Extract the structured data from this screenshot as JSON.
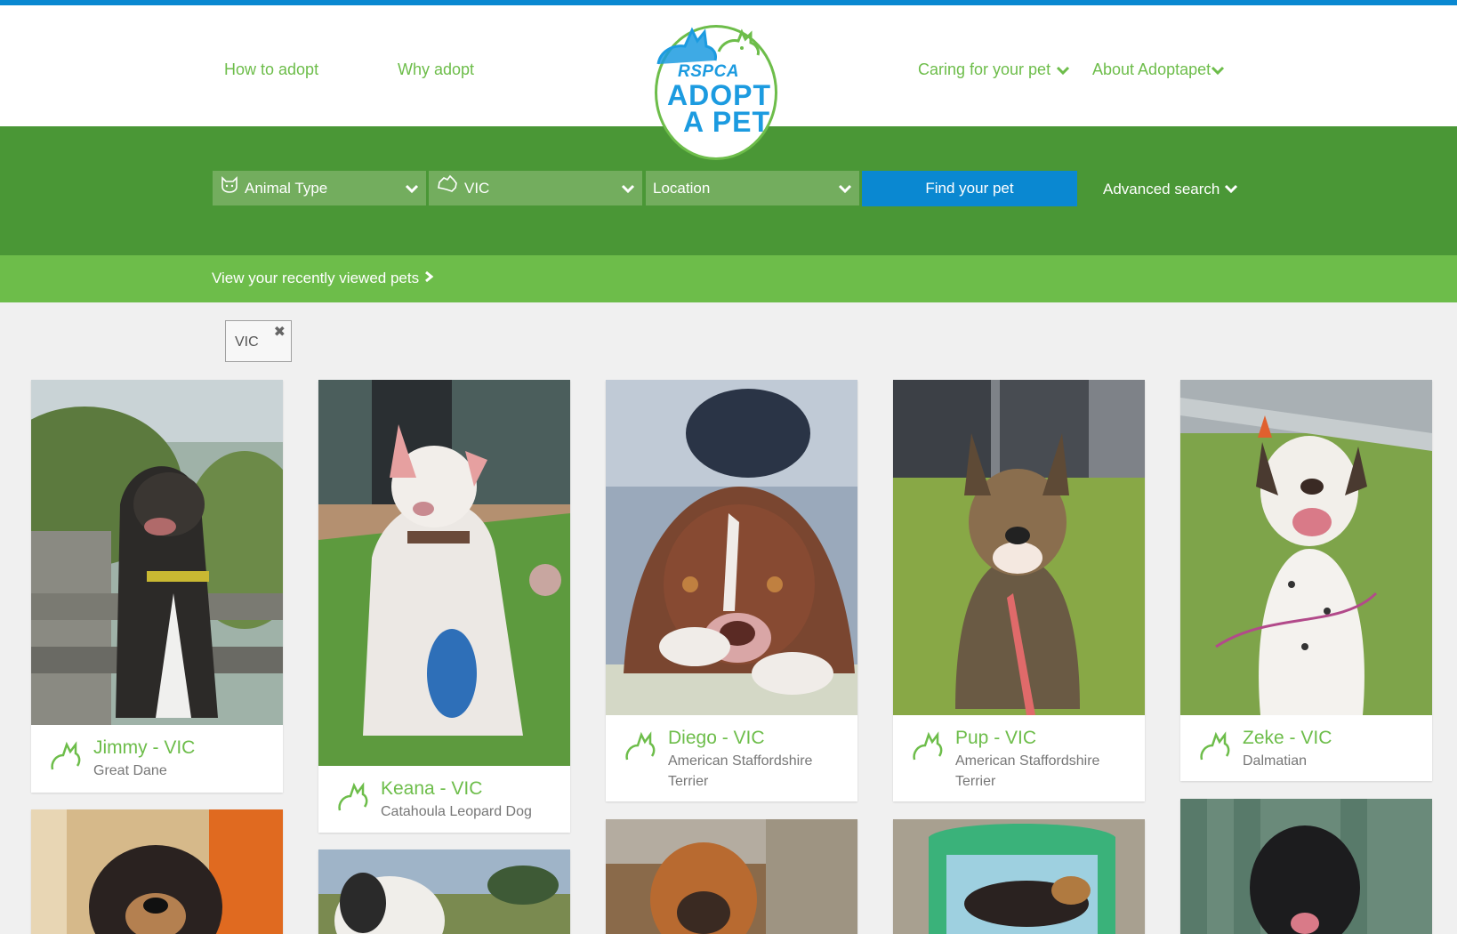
{
  "nav": {
    "how_to_adopt": "How to adopt",
    "why_adopt": "Why adopt",
    "caring": "Caring for your pet",
    "about": "About Adoptapet"
  },
  "logo": {
    "line1": "RSPCA",
    "line2": "ADOPT",
    "line3": "A PET"
  },
  "search": {
    "animal_type": "Animal Type",
    "state": "VIC",
    "location": "Location",
    "find_button": "Find your pet",
    "advanced": "Advanced search"
  },
  "recent": {
    "link": "View your recently viewed pets"
  },
  "filter": {
    "tag": "VIC",
    "close": "✖"
  },
  "pets": [
    {
      "name": "Jimmy - VIC",
      "breed": "Great Dane"
    },
    {
      "name": "Keana - VIC",
      "breed": "Catahoula Leopard Dog"
    },
    {
      "name": "Diego - VIC",
      "breed": "American Staffordshire Terrier"
    },
    {
      "name": "Pup - VIC",
      "breed": "American Staffordshire Terrier"
    },
    {
      "name": "Zeke - VIC",
      "breed": "Dalmatian"
    }
  ],
  "colors": {
    "brand_blue": "#0a88d1",
    "brand_green": "#6dbd4a",
    "band_green": "#4a9736",
    "select_green": "#73ad5e"
  }
}
